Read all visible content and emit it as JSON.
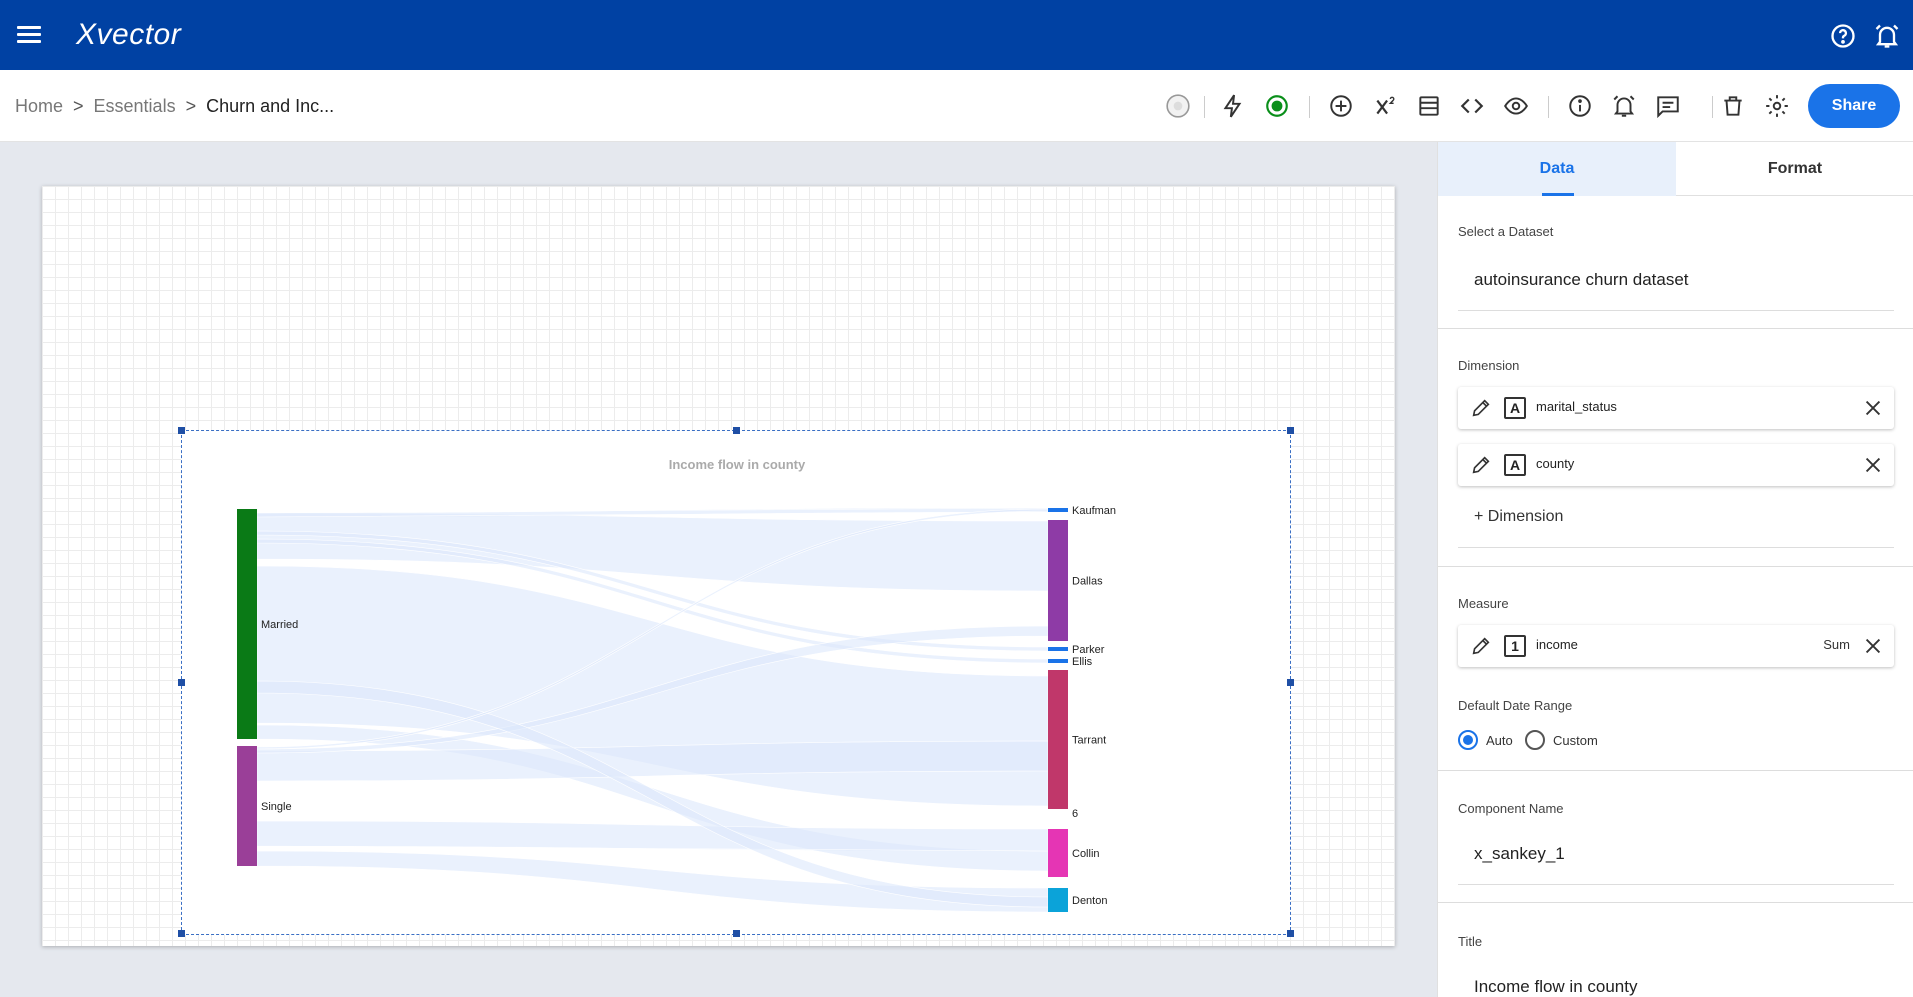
{
  "app": {
    "brand": "Xvector"
  },
  "breadcrumb": {
    "items": [
      "Home",
      "Essentials"
    ],
    "current": "Churn and Inc...",
    "separator": ">"
  },
  "toolbar": {
    "icons": [
      "status-icon",
      "lightning-icon",
      "record-icon",
      "add-circle-icon",
      "superscript-icon",
      "layout-icon",
      "code-icon",
      "eye-icon",
      "info-icon",
      "alarm-icon",
      "comment-icon",
      "trash-icon",
      "settings-icon"
    ],
    "share_label": "Share"
  },
  "canvas": {
    "chart_data": {
      "type": "sankey",
      "title": "Income flow in county",
      "sources": [
        {
          "name": "Married",
          "color": "#0a7a16"
        },
        {
          "name": "Single",
          "color": "#9a3f98"
        }
      ],
      "targets": [
        {
          "name": "Kaufman",
          "color": "#1a73e8"
        },
        {
          "name": "Dallas",
          "color": "#8e3ba6"
        },
        {
          "name": "Parker",
          "color": "#1a73e8"
        },
        {
          "name": "Ellis",
          "color": "#1a73e8"
        },
        {
          "name": "Tarrant",
          "color": "#c0376a"
        },
        {
          "name": "6",
          "color": "#1a73e8"
        },
        {
          "name": "Collin",
          "color": "#e535b4"
        },
        {
          "name": "Denton",
          "color": "#0ba3d9"
        }
      ],
      "link_color": "#dce7fb"
    }
  },
  "panel": {
    "tabs": {
      "data": "Data",
      "format": "Format"
    },
    "dataset": {
      "label": "Select a Dataset",
      "value": "autoinsurance churn dataset"
    },
    "dimension": {
      "label": "Dimension",
      "items": [
        "marital_status",
        "county"
      ],
      "type_glyph": "A",
      "add_label": "+ Dimension"
    },
    "measure": {
      "label": "Measure",
      "item": "income",
      "aggregation": "Sum",
      "type_glyph": "1"
    },
    "date_range": {
      "label": "Default Date Range",
      "auto": "Auto",
      "custom": "Custom"
    },
    "component_name": {
      "label": "Component Name",
      "value": "x_sankey_1"
    },
    "title": {
      "label": "Title",
      "value": "Income flow in county"
    }
  }
}
